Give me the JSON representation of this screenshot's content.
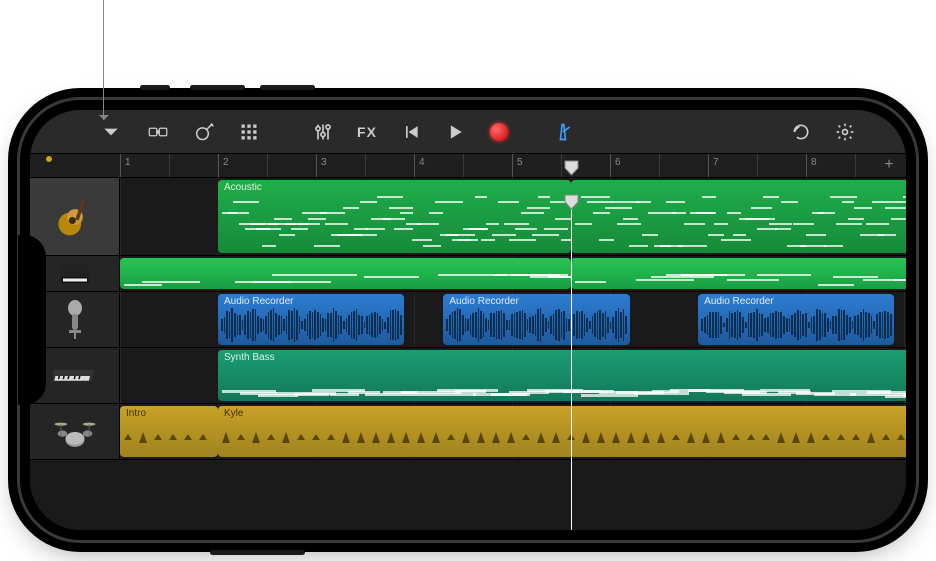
{
  "callout_target": "track-header-acoustic",
  "toolbar": {
    "fx_label": "FX"
  },
  "ruler": {
    "bars": [
      "1",
      "2",
      "3",
      "4",
      "5",
      "6",
      "7",
      "8"
    ],
    "playhead_bar": 5.6,
    "add_label": "+"
  },
  "colors": {
    "midi_green": "#1fae4a",
    "audio_blue": "#2d7dd2",
    "synth_teal": "#1a9e72",
    "drummer_gold": "#c9a227",
    "record_red": "#cc0000",
    "metronome_blue": "#3aa0ff"
  },
  "tracks": [
    {
      "id": "acoustic",
      "instrument_icon": "acoustic-guitar",
      "selected": true,
      "height": "lg",
      "regions": [
        {
          "label": "Acoustic",
          "color": "green",
          "start": 1.0,
          "end": 4.6,
          "kind": "midi"
        },
        {
          "label": "",
          "color": "green",
          "start": 4.6,
          "end": 8.4,
          "kind": "midi"
        }
      ]
    },
    {
      "id": "keys",
      "instrument_icon": "grand-piano",
      "selected": false,
      "height": "sm",
      "regions": [
        {
          "label": "",
          "color": "green2",
          "start": 0.0,
          "end": 4.6,
          "kind": "midi-sparse"
        },
        {
          "label": "",
          "color": "green2",
          "start": 4.6,
          "end": 8.4,
          "kind": "midi-sparse"
        }
      ]
    },
    {
      "id": "vocal",
      "instrument_icon": "microphone",
      "selected": false,
      "height": "md",
      "regions": [
        {
          "label": "Audio Recorder",
          "color": "blue",
          "start": 1.0,
          "end": 2.9,
          "kind": "audio"
        },
        {
          "label": "Audio Recorder",
          "color": "blue",
          "start": 3.3,
          "end": 5.2,
          "kind": "audio"
        },
        {
          "label": "Audio Recorder",
          "color": "blue",
          "start": 5.9,
          "end": 7.9,
          "kind": "audio"
        }
      ]
    },
    {
      "id": "synthbass",
      "instrument_icon": "keyboard-synth",
      "selected": false,
      "height": "md",
      "regions": [
        {
          "label": "Synth Bass",
          "color": "teal",
          "start": 1.0,
          "end": 8.4,
          "kind": "midi-bass"
        }
      ]
    },
    {
      "id": "drummer",
      "instrument_icon": "drum-kit",
      "selected": false,
      "height": "md",
      "regions": [
        {
          "label": "Intro",
          "color": "gold",
          "start": 0.0,
          "end": 1.0,
          "kind": "drummer"
        },
        {
          "label": "Kyle",
          "color": "gold",
          "start": 1.0,
          "end": 8.4,
          "kind": "drummer"
        }
      ]
    }
  ]
}
